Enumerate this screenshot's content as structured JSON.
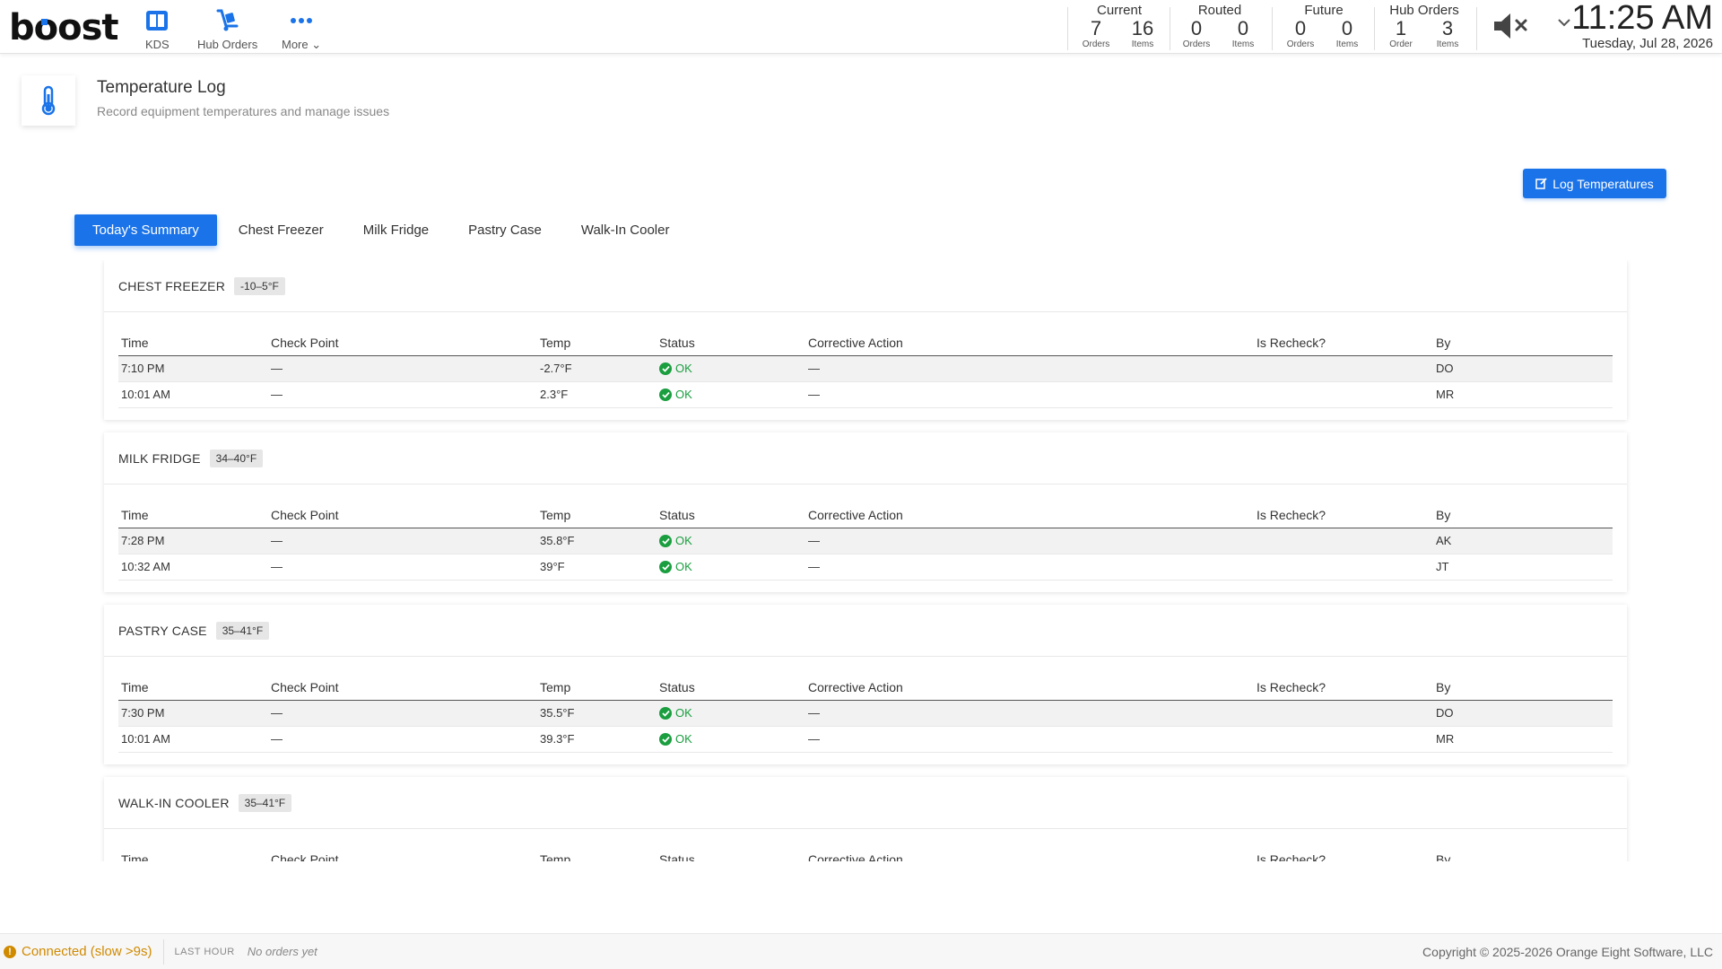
{
  "app": {
    "logo": "boost",
    "brand_color": "#1a73e8"
  },
  "nav": [
    {
      "label": "KDS",
      "icon": "kds-icon"
    },
    {
      "label": "Hub Orders",
      "icon": "hand-truck-icon"
    },
    {
      "label": "More ⌄",
      "icon": "more-dots-icon"
    }
  ],
  "stats": [
    {
      "title": "Current",
      "a_num": "7",
      "a_unit": "Orders",
      "b_num": "16",
      "b_unit": "Items"
    },
    {
      "title": "Routed",
      "a_num": "0",
      "a_unit": "Orders",
      "b_num": "0",
      "b_unit": "Items"
    },
    {
      "title": "Future",
      "a_num": "0",
      "a_unit": "Orders",
      "b_num": "0",
      "b_unit": "Items"
    },
    {
      "title": "Hub Orders",
      "a_num": "1",
      "a_unit": "Order",
      "b_num": "3",
      "b_unit": "Items"
    }
  ],
  "clock": {
    "time": "11:25 AM",
    "date": "Tuesday, Jul 28, 2026"
  },
  "page": {
    "title": "Temperature Log",
    "subtitle": "Record equipment temperatures and manage issues",
    "icon": "thermometer-icon"
  },
  "log_button": "Log Temperatures",
  "tabs": [
    "Today's Summary",
    "Chest Freezer",
    "Milk Fridge",
    "Pastry Case",
    "Walk-In Cooler"
  ],
  "columns": [
    "Time",
    "Check Point",
    "Temp",
    "Status",
    "Corrective Action",
    "Is Recheck?",
    "By"
  ],
  "sections": [
    {
      "name": "CHEST FREEZER",
      "range": "-10–5°F",
      "rows": [
        {
          "time": "7:10 PM",
          "check": "—",
          "temp": "-2.7°F",
          "status": "OK",
          "action": "—",
          "recheck": "",
          "by": "DO"
        },
        {
          "time": "10:01 AM",
          "check": "—",
          "temp": "2.3°F",
          "status": "OK",
          "action": "—",
          "recheck": "",
          "by": "MR"
        }
      ]
    },
    {
      "name": "MILK FRIDGE",
      "range": "34–40°F",
      "rows": [
        {
          "time": "7:28 PM",
          "check": "—",
          "temp": "35.8°F",
          "status": "OK",
          "action": "—",
          "recheck": "",
          "by": "AK"
        },
        {
          "time": "10:32 AM",
          "check": "—",
          "temp": "39°F",
          "status": "OK",
          "action": "—",
          "recheck": "",
          "by": "JT"
        }
      ]
    },
    {
      "name": "PASTRY CASE",
      "range": "35–41°F",
      "rows": [
        {
          "time": "7:30 PM",
          "check": "—",
          "temp": "35.5°F",
          "status": "OK",
          "action": "—",
          "recheck": "",
          "by": "DO"
        },
        {
          "time": "10:01 AM",
          "check": "—",
          "temp": "39.3°F",
          "status": "OK",
          "action": "—",
          "recheck": "",
          "by": "MR"
        }
      ]
    },
    {
      "name": "WALK-IN COOLER",
      "range": "35–41°F",
      "rows": []
    }
  ],
  "footer": {
    "connection": "Connected (slow >9s)",
    "last_hour_label": "LAST HOUR",
    "last_hour_value": "No orders yet",
    "copyright": "Copyright © 2025-2026 Orange Eight Software, LLC"
  }
}
